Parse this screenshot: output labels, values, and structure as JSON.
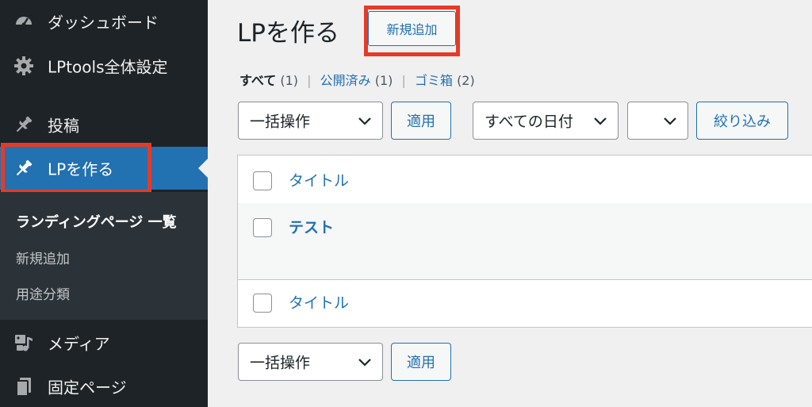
{
  "sidebar": {
    "items": [
      {
        "label": "ダッシュボード",
        "icon": "dashboard-icon"
      },
      {
        "label": "LPtools全体設定",
        "icon": "gear-icon"
      },
      {
        "label": "投稿",
        "icon": "pin-icon"
      },
      {
        "label": "LPを作る",
        "icon": "pin-icon"
      },
      {
        "label": "メディア",
        "icon": "media-icon"
      },
      {
        "label": "固定ページ",
        "icon": "page-icon"
      }
    ],
    "submenu": [
      {
        "label": "ランディングページ 一覧"
      },
      {
        "label": "新規追加"
      },
      {
        "label": "用途分類"
      }
    ]
  },
  "main": {
    "title": "LPを作る",
    "add_new_label": "新規追加",
    "filters": {
      "all_label": "すべて",
      "all_count": "(1)",
      "published_label": "公開済み",
      "published_count": "(1)",
      "trash_label": "ゴミ箱",
      "trash_count": "(2)"
    },
    "bulk_action": "一括操作",
    "apply_label": "適用",
    "date_filter": "すべての日付",
    "category_filter": "",
    "filter_label": "絞り込み",
    "table": {
      "header_title": "タイトル",
      "rows": [
        {
          "title": "テスト"
        }
      ],
      "footer_title": "タイトル"
    }
  },
  "colors": {
    "sidebar_bg": "#1d2327",
    "accent": "#2271b1",
    "highlight": "#e53b26"
  }
}
